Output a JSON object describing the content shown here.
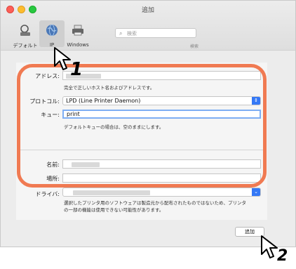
{
  "window": {
    "title": "追加"
  },
  "toolbar": {
    "items": [
      {
        "label": "デフォルト",
        "icon": "default-printer-icon"
      },
      {
        "label": "IP",
        "icon": "globe-icon"
      },
      {
        "label": "Windows",
        "icon": "windows-printer-icon"
      }
    ],
    "search_placeholder": "検索",
    "search_label": "検索"
  },
  "form": {
    "address_label": "アドレス:",
    "address_hint": "完全で正しいホスト名およびアドレスです。",
    "protocol_label": "プロトコル:",
    "protocol_value": "LPD (Line Printer Daemon)",
    "queue_label": "キュー:",
    "queue_value": "print",
    "queue_hint": "デフォルトキューの場合は、空のままにします。",
    "name_label": "名前:",
    "location_label": "場所:",
    "driver_label": "ドライバ:",
    "driver_note_1": "選択したプリンタ用のソフトウェアは製造元から配布されたものではないため、プリンタ",
    "driver_note_2": "の一部の機能は使用できない可能性があります。"
  },
  "add_button": "追加",
  "annotations": {
    "step1": "1",
    "step2": "2"
  },
  "colors": {
    "highlight": "#f07a52",
    "accent": "#3478f6"
  }
}
